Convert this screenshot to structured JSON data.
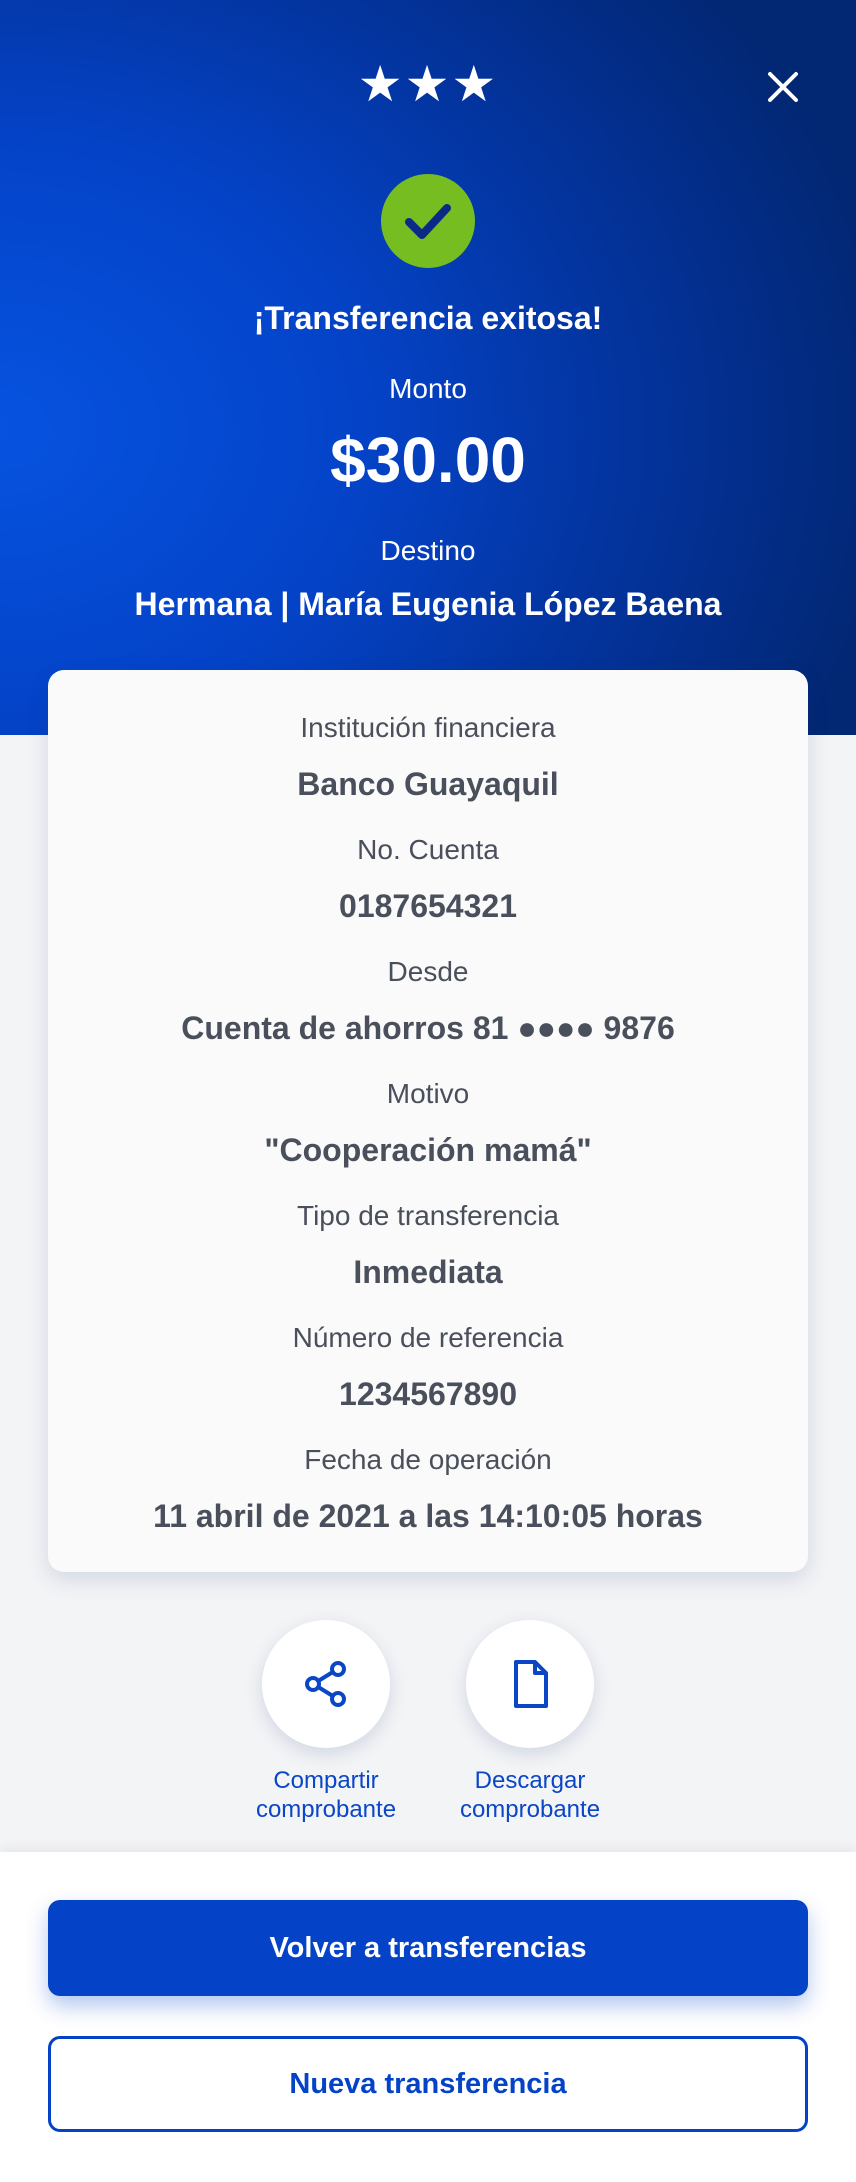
{
  "header": {
    "stars": "★★★",
    "close_icon": "close-icon",
    "status_icon": "check-circle-icon",
    "title": "¡Transferencia exitosa!",
    "amount_label": "Monto",
    "amount": "$30.00",
    "destination_label": "Destino",
    "destination": "Hermana | María Eugenia López Baena"
  },
  "details": [
    {
      "label": "Institución financiera",
      "value": "Banco Guayaquil"
    },
    {
      "label": "No. Cuenta",
      "value": "0187654321"
    },
    {
      "label": "Desde",
      "value": "Cuenta de ahorros 81 ●●●● 9876"
    },
    {
      "label": "Motivo",
      "value": "\"Cooperación mamá\""
    },
    {
      "label": "Tipo de transferencia",
      "value": "Inmediata"
    },
    {
      "label": "Número de referencia",
      "value": "1234567890"
    },
    {
      "label": "Fecha de operación",
      "value": "11 abril de 2021 a las 14:10:05 horas"
    }
  ],
  "actions": {
    "share": {
      "icon": "share-icon",
      "line1": "Compartir",
      "line2": "comprobante"
    },
    "download": {
      "icon": "document-icon",
      "line1": "Descargar",
      "line2": "comprobante"
    }
  },
  "buttons": {
    "primary": "Volver a transferencias",
    "secondary": "Nueva transferencia"
  },
  "colors": {
    "brand_blue": "#0443c8",
    "success_green": "#76bd22",
    "text_gray": "#4a4f5c"
  }
}
